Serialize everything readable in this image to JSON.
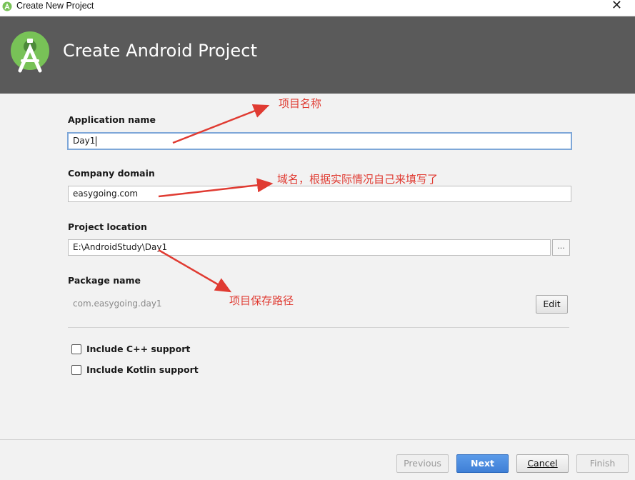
{
  "window": {
    "title": "Create New Project",
    "close_glyph": "✕"
  },
  "header": {
    "heading": "Create Android Project"
  },
  "form": {
    "app_name": {
      "label": "Application name",
      "value": "Day1"
    },
    "company_domain": {
      "label": "Company domain",
      "value": "easygoing.com"
    },
    "project_location": {
      "label": "Project location",
      "value": "E:\\AndroidStudy\\Day1",
      "browse_label": "..."
    },
    "package_name": {
      "label": "Package name",
      "value": "com.easygoing.day1",
      "edit_label": "Edit"
    },
    "include_cpp": {
      "label": "Include C++ support",
      "checked": false
    },
    "include_kotlin": {
      "label": "Include Kotlin support",
      "checked": false
    }
  },
  "annotations": {
    "project_name_note": "项目名称",
    "domain_note": "域名，根据实际情况自己来填写了",
    "location_note": "项目保存路径"
  },
  "footer": {
    "previous_label": "Previous",
    "next_label": "Next",
    "cancel_label": "Cancel",
    "finish_label": "Finish"
  },
  "colors": {
    "header_bg": "#5a5a5a",
    "accent_blue": "#3f7fd6",
    "annotation_red": "#e03b32",
    "android_green": "#78c257"
  },
  "icons": [
    "android-studio-icon",
    "close-icon",
    "ellipsis-icon",
    "checkbox-icon"
  ]
}
